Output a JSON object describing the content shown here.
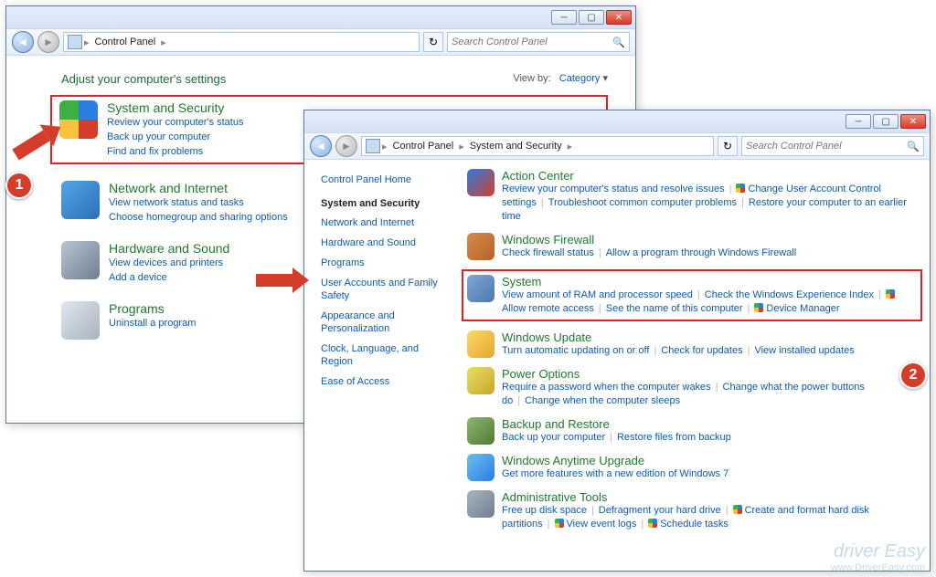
{
  "w1": {
    "breadcrumb": [
      "Control Panel"
    ],
    "search_placeholder": "Search Control Panel",
    "heading": "Adjust your computer's settings",
    "viewby_label": "View by:",
    "viewby_value": "Category",
    "categories": [
      {
        "title": "System and Security",
        "links": [
          "Review your computer's status",
          "Back up your computer",
          "Find and fix problems"
        ],
        "icon": "shield"
      },
      {
        "title": "Network and Internet",
        "links": [
          "View network status and tasks",
          "Choose homegroup and sharing options"
        ],
        "icon": "globe"
      },
      {
        "title": "Hardware and Sound",
        "links": [
          "View devices and printers",
          "Add a device"
        ],
        "icon": "printer"
      },
      {
        "title": "Programs",
        "links": [
          "Uninstall a program"
        ],
        "icon": "disc"
      }
    ]
  },
  "w2": {
    "breadcrumb": [
      "Control Panel",
      "System and Security"
    ],
    "search_placeholder": "Search Control Panel",
    "sidebar": {
      "home": "Control Panel Home",
      "items": [
        "System and Security",
        "Network and Internet",
        "Hardware and Sound",
        "Programs",
        "User Accounts and Family Safety",
        "Appearance and Personalization",
        "Clock, Language, and Region",
        "Ease of Access"
      ]
    },
    "sections": [
      {
        "title": "Action Center",
        "tasks": [
          "Review your computer's status and resolve issues",
          "Change User Account Control settings",
          "Troubleshoot common computer problems",
          "Restore your computer to an earlier time"
        ],
        "shield_idx": [
          1
        ]
      },
      {
        "title": "Windows Firewall",
        "tasks": [
          "Check firewall status",
          "Allow a program through Windows Firewall"
        ],
        "shield_idx": []
      },
      {
        "title": "System",
        "tasks": [
          "View amount of RAM and processor speed",
          "Check the Windows Experience Index",
          "Allow remote access",
          "See the name of this computer",
          "Device Manager"
        ],
        "shield_idx": [
          2,
          4
        ]
      },
      {
        "title": "Windows Update",
        "tasks": [
          "Turn automatic updating on or off",
          "Check for updates",
          "View installed updates"
        ],
        "shield_idx": []
      },
      {
        "title": "Power Options",
        "tasks": [
          "Require a password when the computer wakes",
          "Change what the power buttons do",
          "Change when the computer sleeps"
        ],
        "shield_idx": []
      },
      {
        "title": "Backup and Restore",
        "tasks": [
          "Back up your computer",
          "Restore files from backup"
        ],
        "shield_idx": []
      },
      {
        "title": "Windows Anytime Upgrade",
        "tasks": [
          "Get more features with a new edition of Windows 7"
        ],
        "shield_idx": []
      },
      {
        "title": "Administrative Tools",
        "tasks": [
          "Free up disk space",
          "Defragment your hard drive",
          "Create and format hard disk partitions",
          "View event logs",
          "Schedule tasks"
        ],
        "shield_idx": [
          2,
          3,
          4
        ]
      }
    ]
  },
  "annotations": {
    "step1": "1",
    "step2": "2"
  },
  "watermark": {
    "brand": "driver Easy",
    "url": "www.DriverEasy.com"
  },
  "icon_colors": {
    "shield": "linear-gradient(135deg,#2a7de1,#d43d2a,#f9c23c,#3cb043)",
    "globe": "linear-gradient(135deg,#53a6e8,#2b6fb5)",
    "printer": "linear-gradient(135deg,#b9c6d3,#6e7f90)",
    "disc": "linear-gradient(135deg,#e0e6ec,#a8b4c0)",
    "flag": "linear-gradient(135deg,#2a7de1,#d43d2a)",
    "brick": "linear-gradient(135deg,#d88a4a,#b56328)",
    "chip": "linear-gradient(135deg,#7fa8d9,#4b77aa)",
    "winup": "linear-gradient(135deg,#f9d96b,#e8a628)",
    "bulb": "linear-gradient(135deg,#e8e064,#c6a726)",
    "vault": "linear-gradient(135deg,#8fb56c,#4f7a39)",
    "win": "linear-gradient(135deg,#6bbff0,#2a7de1)",
    "tools": "linear-gradient(135deg,#a8b4c0,#6e7f90)"
  }
}
